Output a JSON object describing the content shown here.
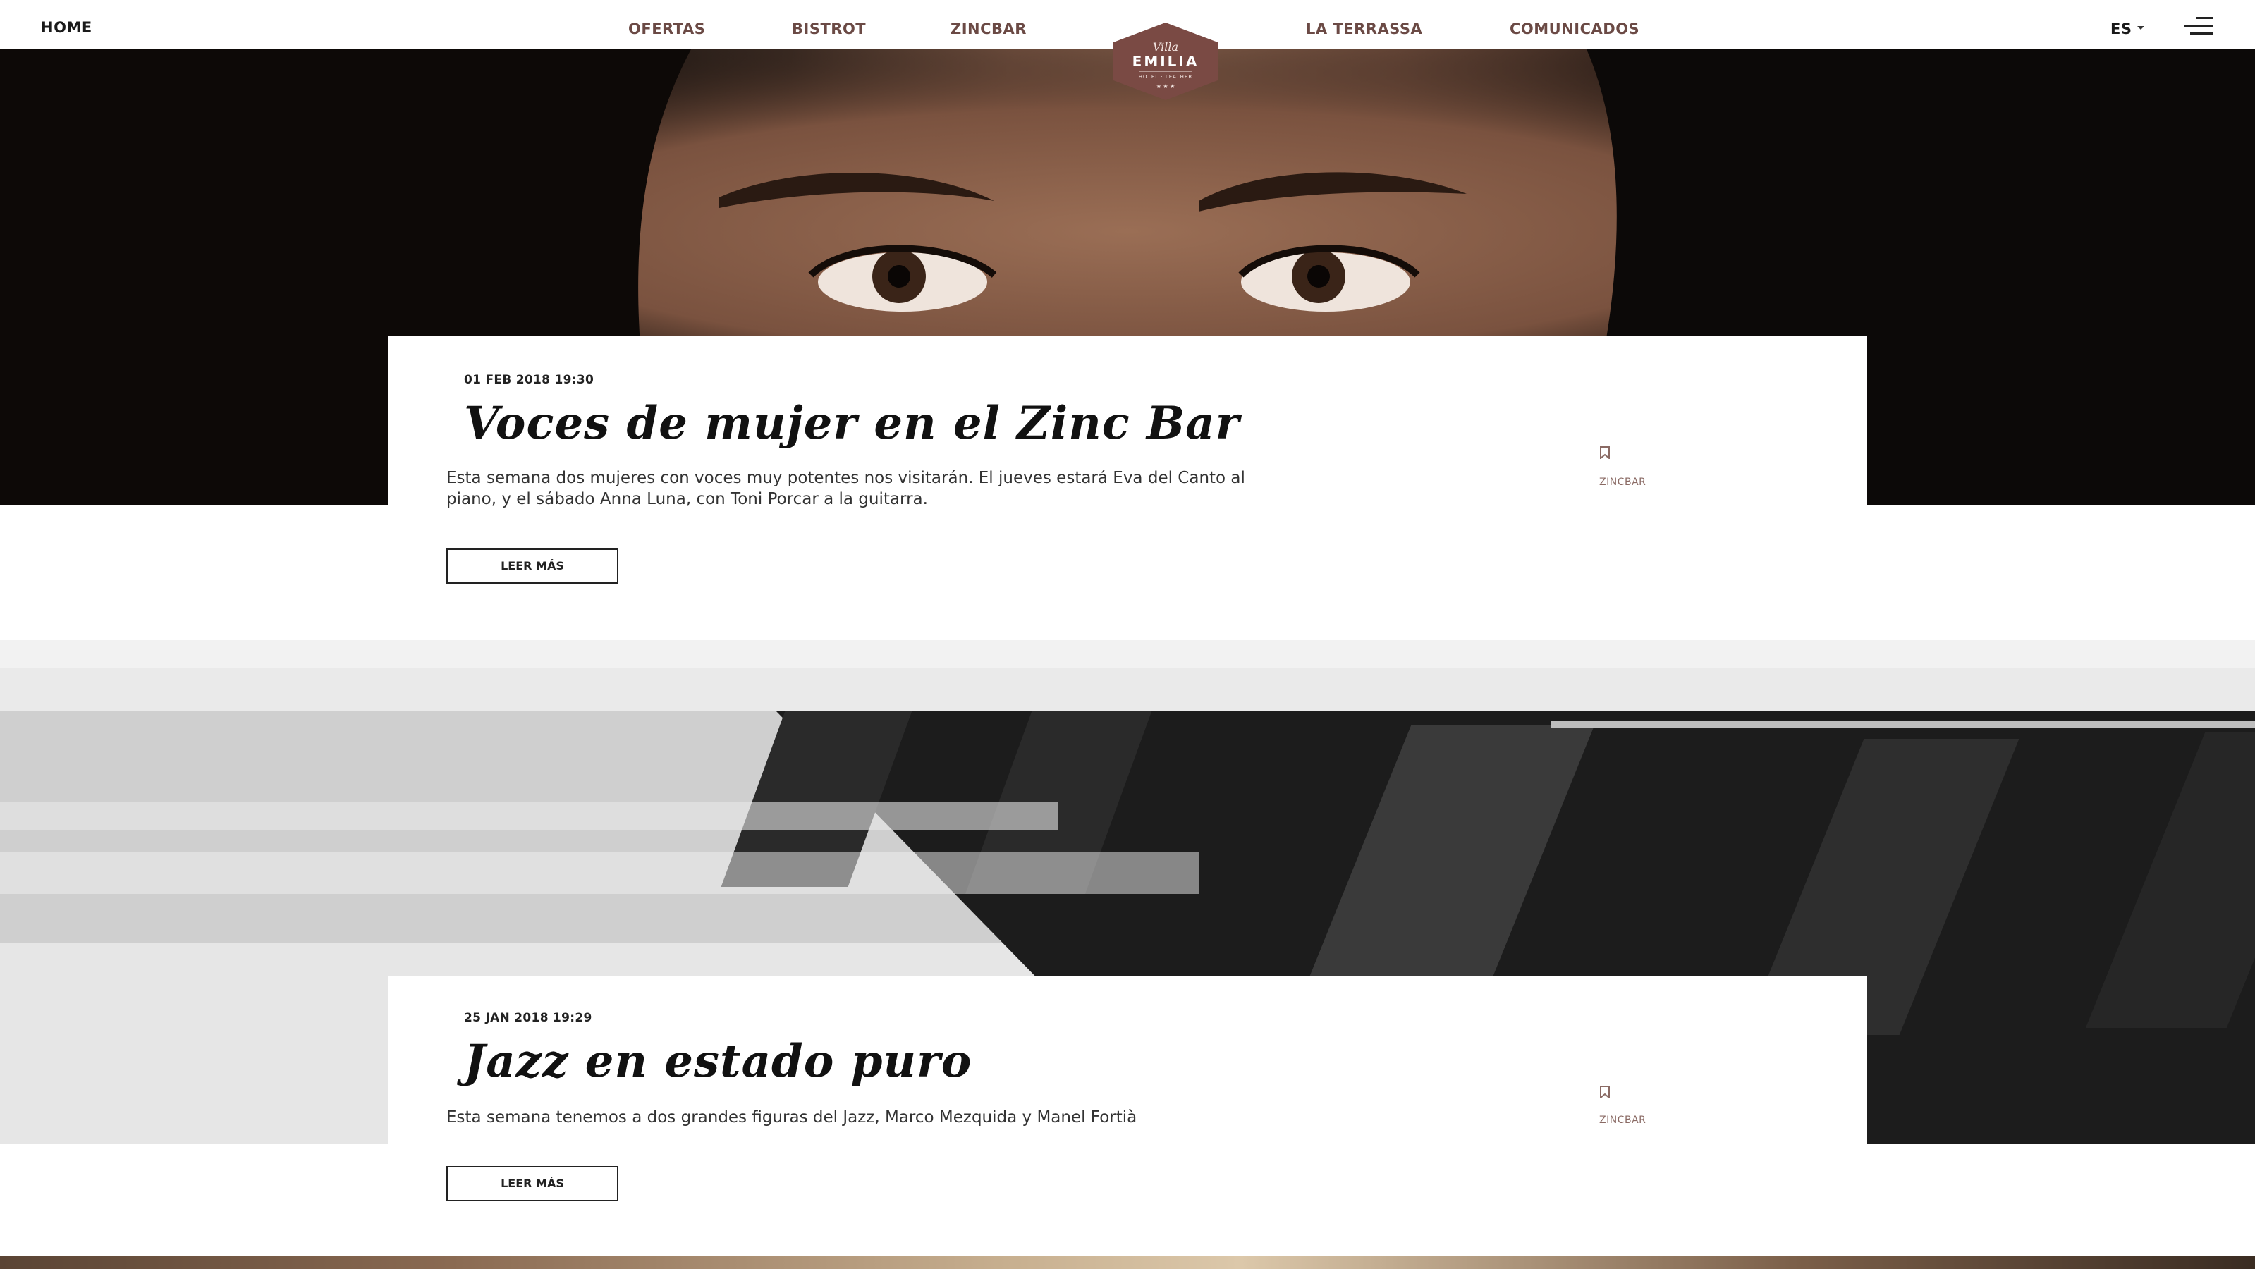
{
  "nav": {
    "home": "HOME",
    "links": [
      "OFERTAS",
      "BISTROT",
      "ZINCBAR",
      "LA TERRASSA",
      "COMUNICADOS"
    ],
    "language": "ES"
  },
  "logo": {
    "script": "Villa",
    "name": "EMILIA",
    "tagline": "HOTEL · LEATHER"
  },
  "colors": {
    "brand": "#6b4a45",
    "accent_category": "#8a6a64",
    "text": "#222222"
  },
  "posts": [
    {
      "date": "01 FEB 2018 19:30",
      "title": "Voces de mujer en el Zinc Bar",
      "excerpt": "Esta semana dos mujeres con voces muy potentes nos visitarán. El jueves estará Eva del Canto al piano, y el sábado Anna Luna, con Toni Porcar a la guitarra.",
      "button": "LEER MÁS",
      "category": "ZINCBAR",
      "category_icon": "bookmark-icon"
    },
    {
      "date": "25 JAN 2018 19:29",
      "title": "Jazz en estado puro",
      "excerpt": "Esta semana tenemos a dos grandes figuras del Jazz, Marco Mezquida y Manel Fortià",
      "button": "LEER MÁS",
      "category": "ZINCBAR",
      "category_icon": "bookmark-icon"
    }
  ]
}
